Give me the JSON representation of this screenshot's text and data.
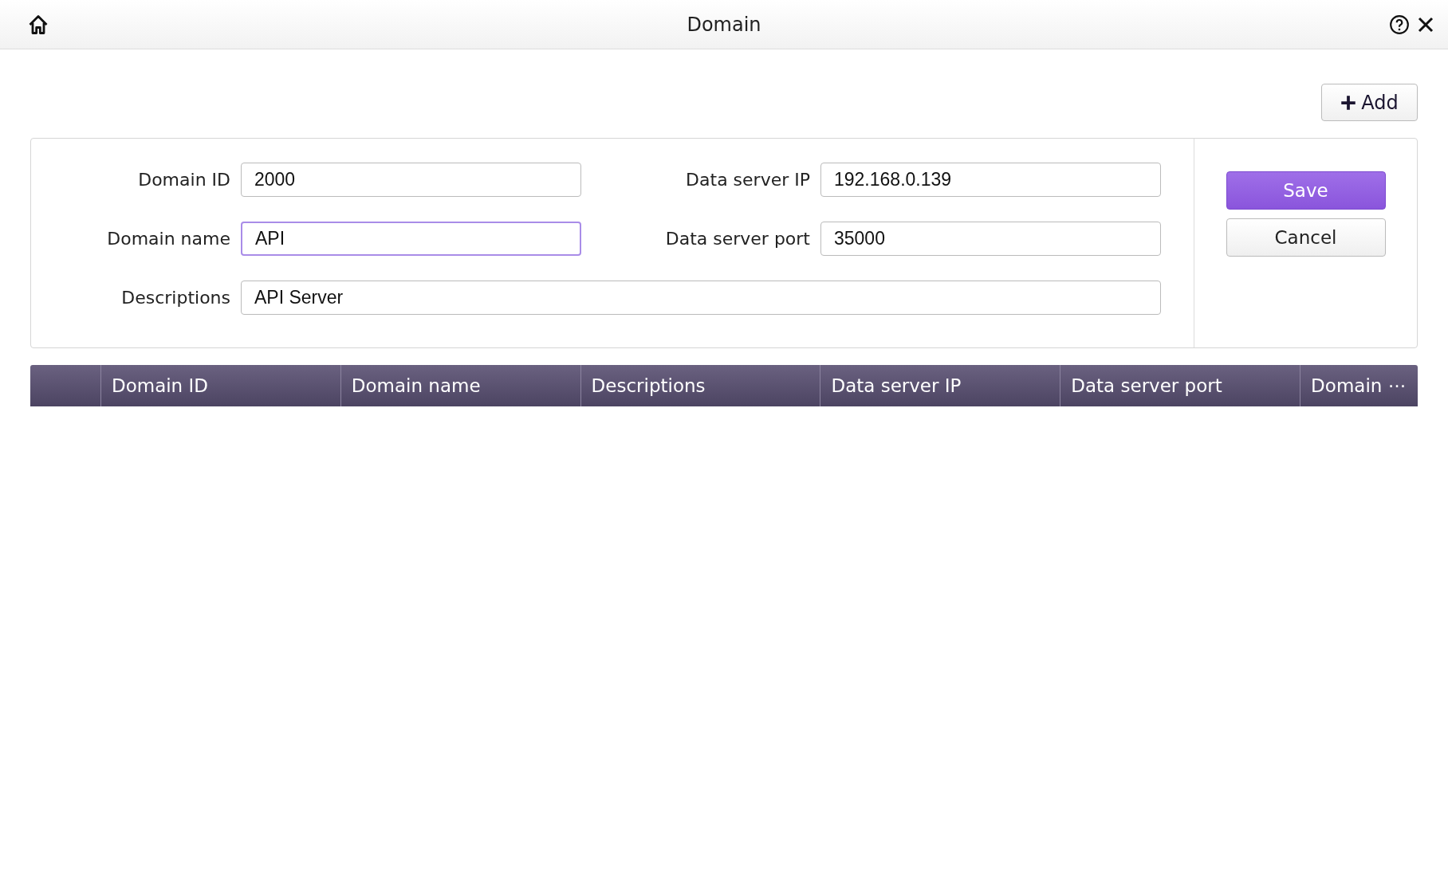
{
  "window": {
    "title": "Domain"
  },
  "toolbar": {
    "add_button": "Add"
  },
  "form": {
    "fields": [
      {
        "label": "Domain ID",
        "value": "2000",
        "focused": false,
        "wide": false
      },
      {
        "label": "Data server IP",
        "value": "192.168.0.139",
        "focused": false,
        "wide": false
      },
      {
        "label": "Domain name",
        "value": "API",
        "focused": true,
        "wide": false
      },
      {
        "label": "Data server port",
        "value": "35000",
        "focused": false,
        "wide": false
      },
      {
        "label": "Descriptions",
        "value": "API Server",
        "focused": false,
        "wide": true
      }
    ],
    "save_button": "Save",
    "cancel_button": "Cancel"
  },
  "table": {
    "columns": [
      "Domain ID",
      "Domain name",
      "Descriptions",
      "Data server IP",
      "Data server port",
      "Domain ⋯"
    ]
  }
}
